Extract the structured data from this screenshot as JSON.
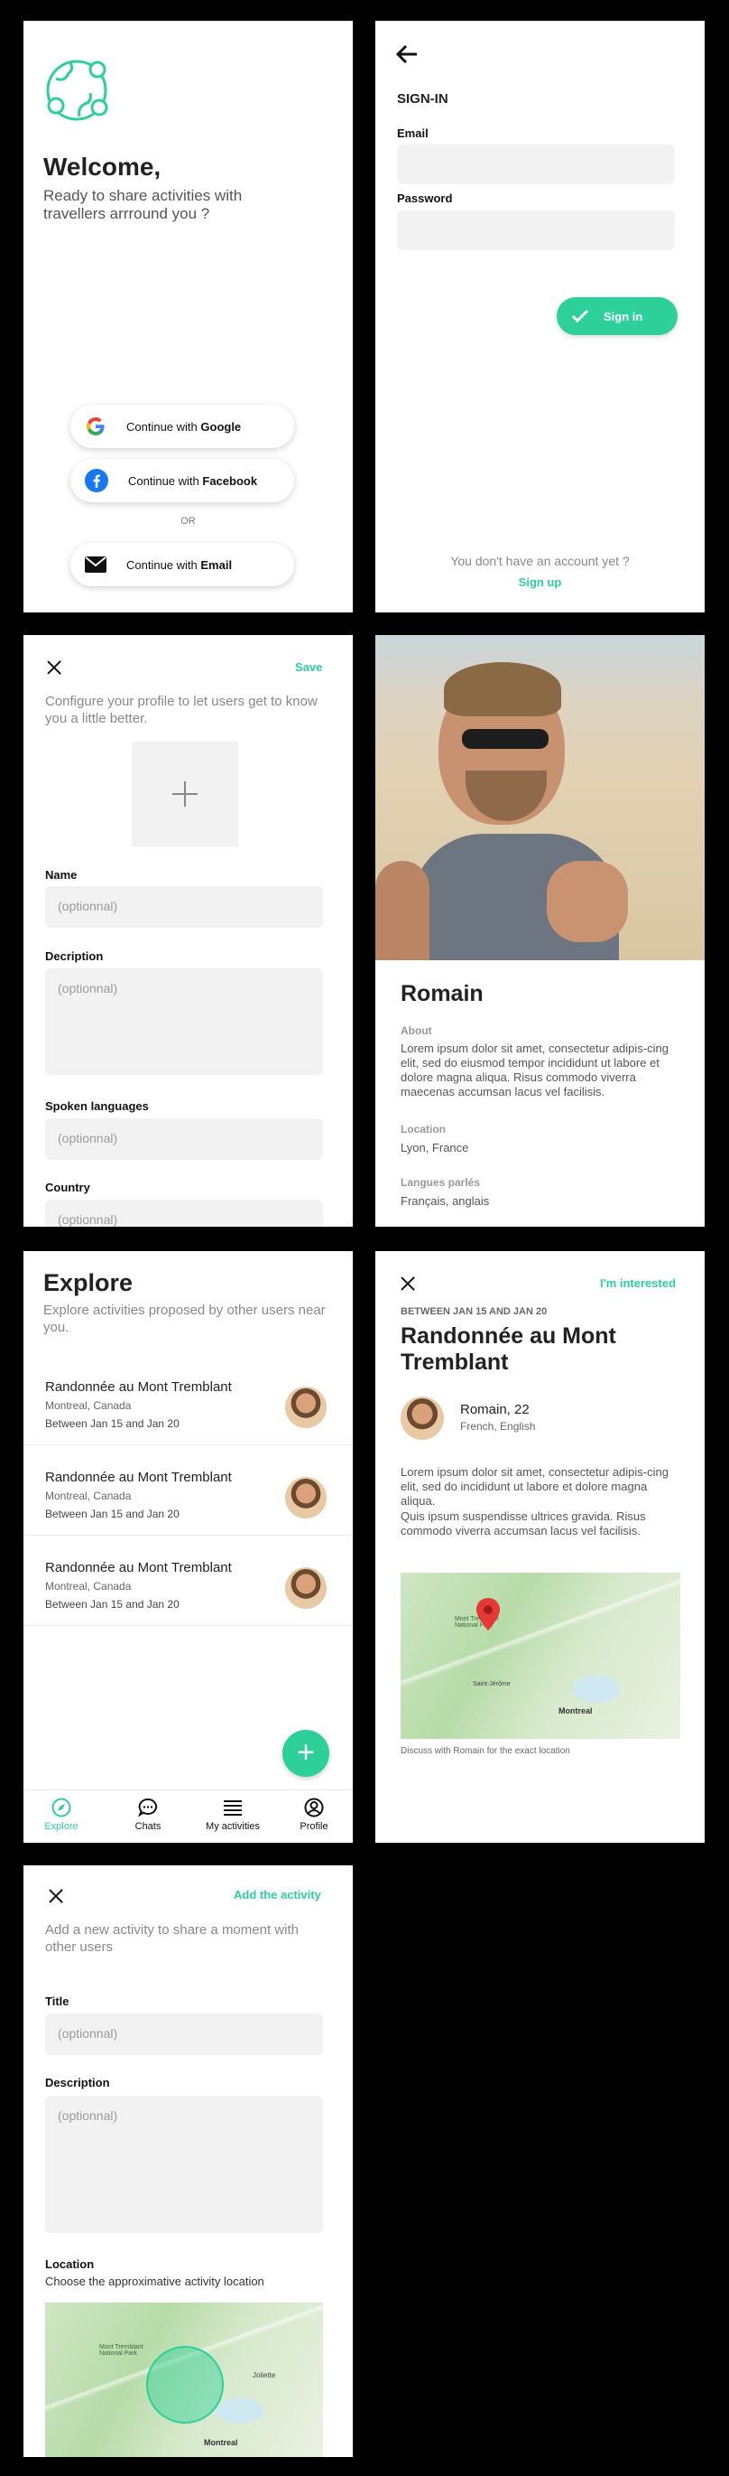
{
  "welcome": {
    "title": "Welcome,",
    "subtitle": "Ready to share activities with travellers arrround you ?",
    "google_prefix": "Continue with ",
    "google_brand": "Google",
    "facebook_prefix": "Continue with ",
    "facebook_brand": "Facebook",
    "or": "OR",
    "email_prefix": "Continue with ",
    "email_brand": "Email"
  },
  "signin": {
    "title": "SIGN-IN",
    "email_label": "Email",
    "password_label": "Password",
    "button": "Sign in",
    "no_account": "You don't have an account yet ?",
    "signup": "Sign up"
  },
  "configure": {
    "save": "Save",
    "intro": "Configure your profile to let users get to know you a little better.",
    "name_label": "Name",
    "name_ph": "(optionnal)",
    "desc_label": "Decription",
    "desc_ph": "(optionnal)",
    "lang_label": "Spoken languages",
    "lang_ph": "(optionnal)",
    "country_label": "Country",
    "country_ph": "(optionnal)"
  },
  "profile": {
    "name": "Romain",
    "about_label": "About",
    "about_text": "Lorem ipsum dolor sit amet, consectetur adipis-cing elit, sed do eiusmod tempor incididunt ut labore et dolore magna aliqua. Risus commodo viverra maecenas accumsan lacus vel facilisis.",
    "location_label": "Location",
    "location": "Lyon, France",
    "lang_label": "Langues parlés",
    "langs": "Français, anglais"
  },
  "explore": {
    "title": "Explore",
    "subtitle": "Explore activities proposed by other users near you.",
    "items": [
      {
        "title": "Randonnée au Mont Tremblant",
        "place": "Montreal, Canada",
        "dates": "Between Jan 15 and Jan 20"
      },
      {
        "title": "Randonnée au Mont Tremblant",
        "place": "Montreal, Canada",
        "dates": "Between Jan 15 and Jan 20"
      },
      {
        "title": "Randonnée au Mont Tremblant",
        "place": "Montreal, Canada",
        "dates": "Between Jan 15 and Jan 20"
      }
    ],
    "fab": "+",
    "tabs": [
      "Explore",
      "Chats",
      "My activities",
      "Profile"
    ]
  },
  "detail": {
    "interested": "I'm interested",
    "dates": "BETWEEN JAN 15 AND JAN 20",
    "title": "Randonnée au Mont Tremblant",
    "host": "Romain, 22",
    "host_langs": "French, English",
    "text1": "Lorem ipsum dolor sit amet, consectetur adipis-cing elit, sed do incididunt ut labore et dolore magna aliqua.",
    "text2": "Quis ipsum suspendisse ultrices gravida. Risus commodo viverra accumsan lacus vel facilisis.",
    "map_note": "Discuss with Romain for the exact location",
    "map_labels": [
      "Mont Tremblant National Park",
      "Montreal",
      "Saint-Jérôme"
    ]
  },
  "add": {
    "action": "Add the activity",
    "intro": "Add a new activity to share a moment with other users",
    "title_label": "Title",
    "title_ph": "(optionnal)",
    "desc_label": "Description",
    "desc_ph": "(optionnal)",
    "loc_label": "Location",
    "loc_sub": "Choose the approximative activity location",
    "map_labels": [
      "Mont Tremblant National Park",
      "Montreal",
      "Joliette"
    ]
  },
  "colors": {
    "accent": "#2ed09a",
    "field": "#f2f2f2",
    "background": "#000000"
  }
}
